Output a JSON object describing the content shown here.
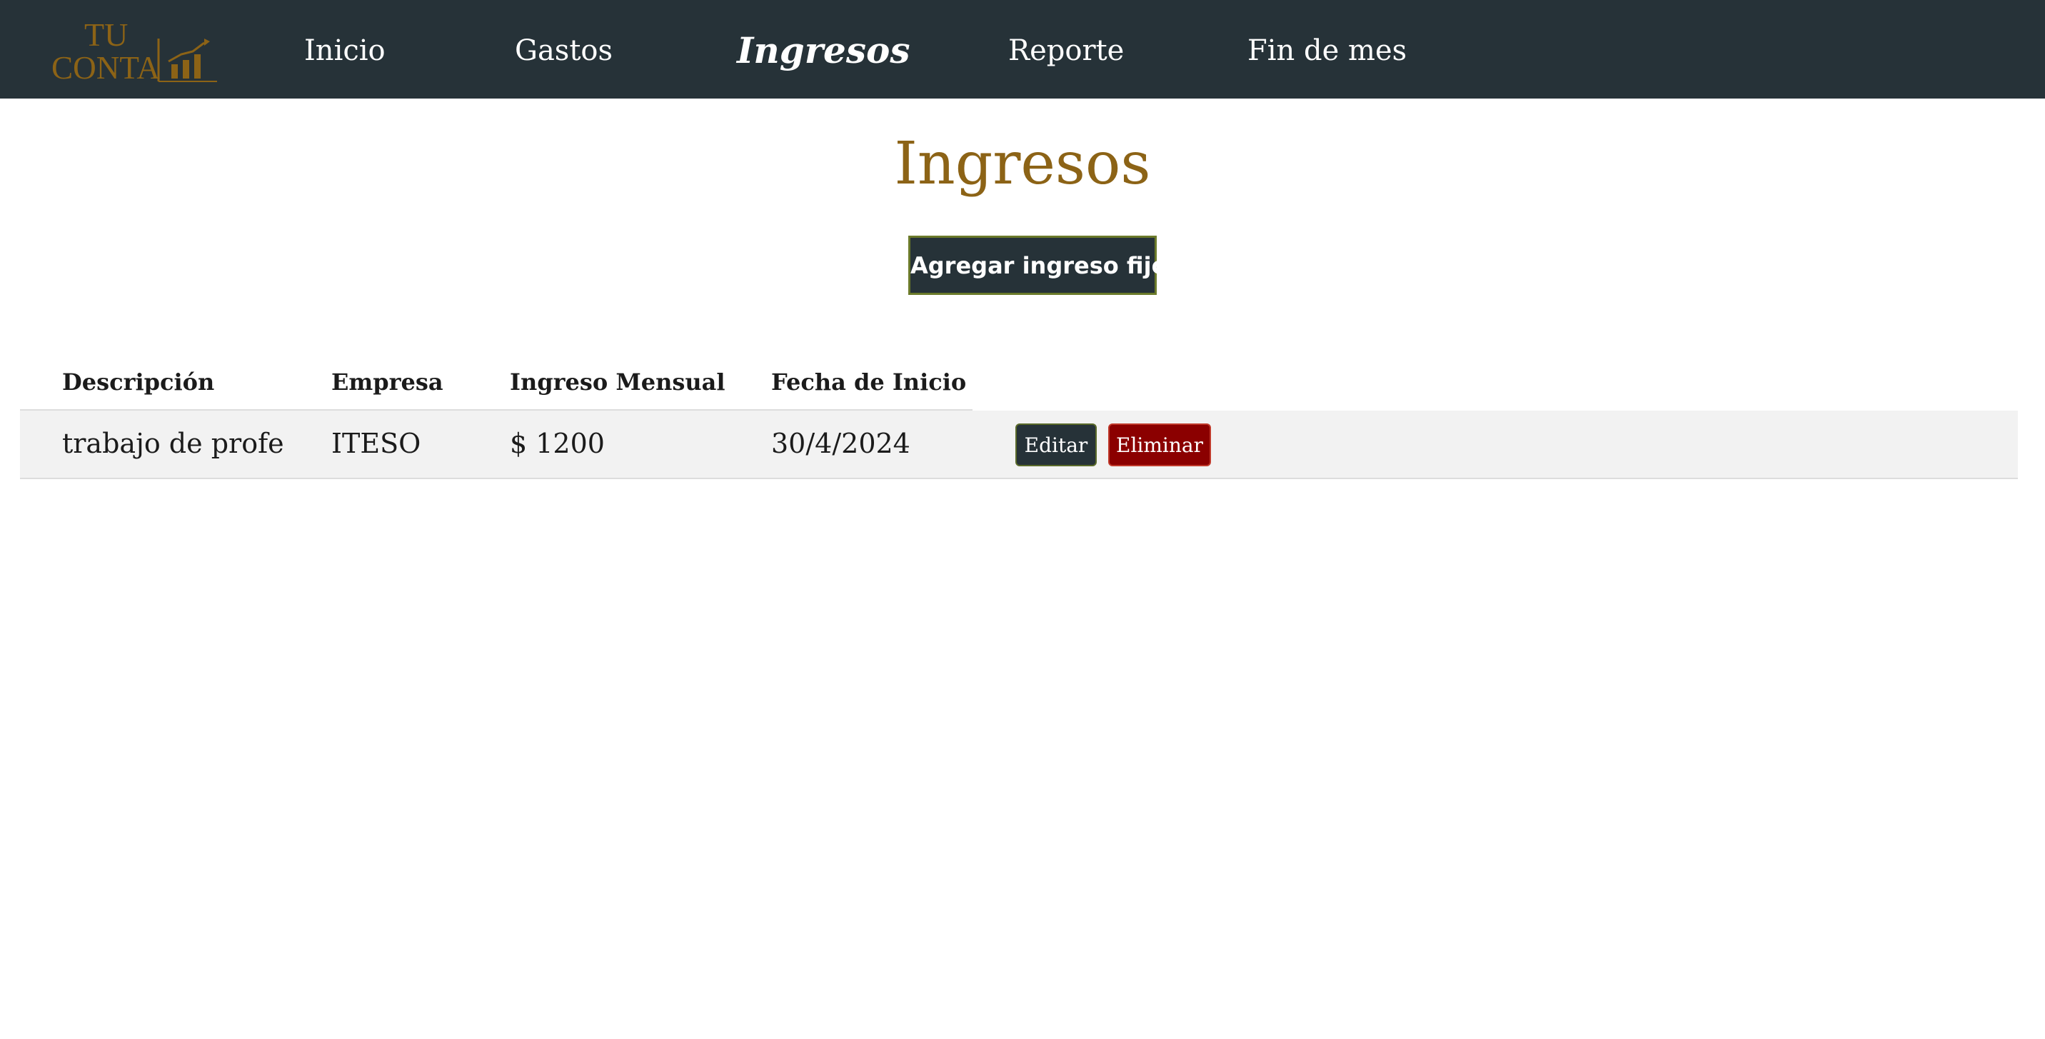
{
  "navbar": {
    "logo": {
      "line1": "TU",
      "line2": "CONTA",
      "icon": "bar-chart-icon"
    },
    "items": [
      {
        "label": "Inicio",
        "active": false
      },
      {
        "label": "Gastos",
        "active": false
      },
      {
        "label": "Ingresos",
        "active": true
      },
      {
        "label": "Reporte",
        "active": false
      },
      {
        "label": "Fin de mes",
        "active": false
      }
    ]
  },
  "page": {
    "title": "Ingresos",
    "add_button_label": "Agregar ingreso fijo"
  },
  "table": {
    "columns": [
      "Descripción",
      "Empresa",
      "Ingreso Mensual",
      "Fecha de Inicio"
    ],
    "rows": [
      {
        "descripcion": "trabajo de profe",
        "empresa": "ITESO",
        "ingreso": "$ 1200",
        "fecha": "30/4/2024",
        "edit_label": "Editar",
        "delete_label": "Eliminar"
      }
    ]
  },
  "colors": {
    "navbar_bg": "#263238",
    "title_gold": "#8c6316",
    "delete_red": "#8b0000",
    "row_bg": "#f2f2f2"
  }
}
